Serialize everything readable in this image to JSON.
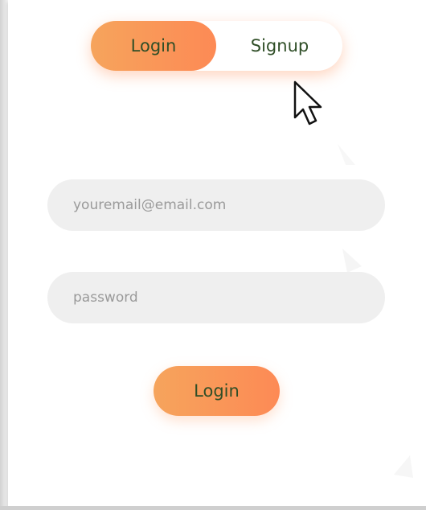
{
  "toggle": {
    "login_label": "Login",
    "signup_label": "Signup"
  },
  "form": {
    "email_placeholder": "youremail@email.com",
    "password_placeholder": "password",
    "submit_label": "Login"
  },
  "colors": {
    "accent_start": "#f6a45c",
    "accent_end": "#fd8a55",
    "label_text": "#2f4e27",
    "input_bg": "#efefef"
  },
  "icons": {
    "cursor": "mouse-pointer-icon"
  }
}
